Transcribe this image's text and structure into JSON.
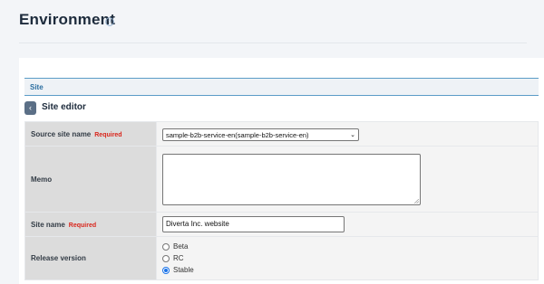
{
  "header": {
    "title": "Environment",
    "help_icon": "question-circle-icon"
  },
  "section": {
    "label": "Site"
  },
  "editor": {
    "back_icon": "chevron-left-icon",
    "title": "Site editor"
  },
  "form": {
    "source_site": {
      "label": "Source site name",
      "required": "Required",
      "selected_value": "sample-b2b-service-en(sample-b2b-service-en)"
    },
    "memo": {
      "label": "Memo",
      "value": ""
    },
    "site_name": {
      "label": "Site name",
      "required": "Required",
      "value": "Diverta Inc. website"
    },
    "release_version": {
      "label": "Release version",
      "options": [
        "Beta",
        "RC",
        "Stable"
      ],
      "selected": "Stable"
    }
  },
  "colors": {
    "accent": "#5b9cc7",
    "required": "#d9261c",
    "label_bg": "#dcdcdc"
  }
}
